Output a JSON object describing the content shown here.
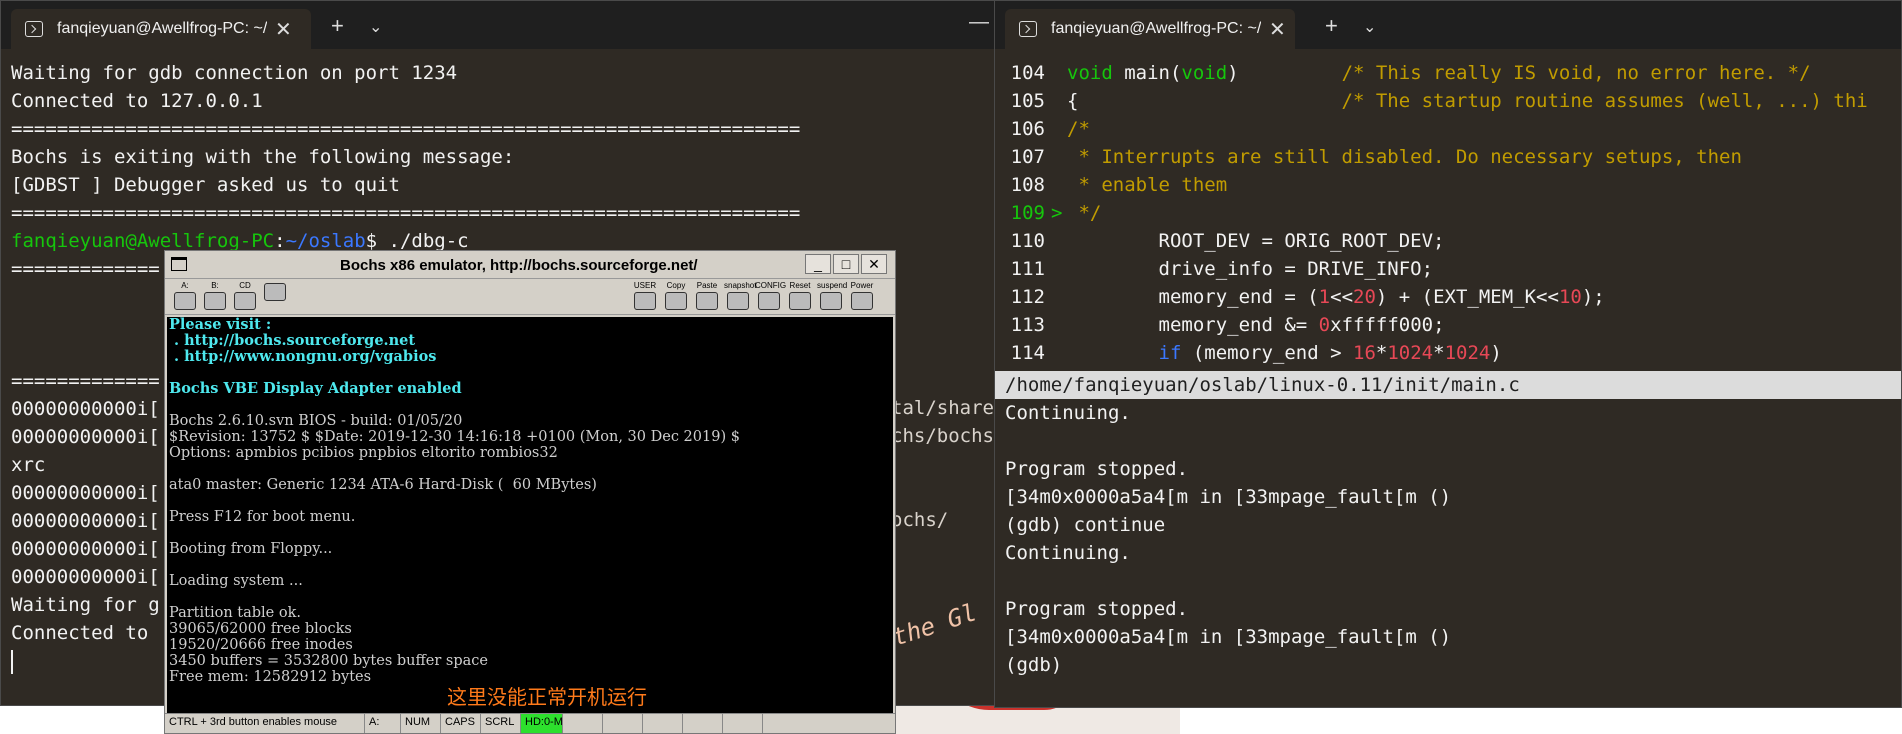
{
  "left_terminal": {
    "tab_title": "fanqieyuan@Awellfrog-PC: ~/",
    "lines": [
      "Waiting for gdb connection on port 1234",
      "Connected to 127.0.0.1",
      "=====================================================================",
      "Bochs is exiting with the following message:",
      "[GDBST ] Debugger asked us to quit",
      "=====================================================================",
      "",
      "=============",
      "",
      "",
      "",
      "=============",
      "00000000000i[",
      "00000000000i[",
      "xrc",
      "00000000000i[",
      "00000000000i[",
      "00000000000i[",
      "00000000000i[",
      "Waiting for g",
      "Connected to "
    ],
    "prompt_user": "fanqieyuan@Awellfrog-PC",
    "prompt_sep": ":",
    "prompt_path": "~/oslab",
    "prompt_cmd": "$ ./dbg-c"
  },
  "right_terminal": {
    "tab_title": "fanqieyuan@Awellfrog-PC: ~/",
    "code_lines": [
      {
        "no": "104",
        "mark": " ",
        "parts": [
          [
            "kw",
            "void"
          ],
          [
            "",
            ""
          ],
          [
            "",
            " main("
          ],
          [
            "kw",
            "void"
          ],
          [
            "",
            ")         "
          ],
          [
            "cm",
            "/* This really IS void, no error here. */"
          ]
        ]
      },
      {
        "no": "105",
        "mark": " ",
        "parts": [
          [
            "",
            "{                       "
          ],
          [
            "cm",
            "/* The startup routine assumes (well, ...) thi"
          ]
        ]
      },
      {
        "no": "106",
        "mark": " ",
        "parts": [
          [
            "cm",
            "/*"
          ]
        ]
      },
      {
        "no": "107",
        "mark": " ",
        "parts": [
          [
            "cm",
            " * Interrupts are still disabled. Do necessary setups, then"
          ]
        ]
      },
      {
        "no": "108",
        "mark": " ",
        "parts": [
          [
            "cm",
            " * enable them"
          ]
        ]
      },
      {
        "no": "109",
        "mark": ">",
        "parts": [
          [
            "cm",
            " */"
          ]
        ]
      },
      {
        "no": "110",
        "mark": " ",
        "parts": [
          [
            "",
            "        ROOT_DEV = ORIG_ROOT_DEV;"
          ]
        ]
      },
      {
        "no": "111",
        "mark": " ",
        "parts": [
          [
            "",
            "        drive_info = DRIVE_INFO;"
          ]
        ]
      },
      {
        "no": "112",
        "mark": " ",
        "parts": [
          [
            "",
            "        memory_end = ("
          ],
          [
            "num",
            "1"
          ],
          [
            "",
            "<<"
          ],
          [
            "num",
            "20"
          ],
          [
            "",
            ") + (EXT_MEM_K<<"
          ],
          [
            "num",
            "10"
          ],
          [
            "",
            ");"
          ]
        ]
      },
      {
        "no": "113",
        "mark": " ",
        "parts": [
          [
            "",
            "        memory_end &= "
          ],
          [
            "num",
            "0"
          ],
          [
            "",
            "xfffff000;"
          ]
        ]
      },
      {
        "no": "114",
        "mark": " ",
        "parts": [
          [
            "",
            "        "
          ],
          [
            "kb",
            "if"
          ],
          [
            "",
            " (memory_end > "
          ],
          [
            "num",
            "16"
          ],
          [
            "",
            "*"
          ],
          [
            "num",
            "1024"
          ],
          [
            "",
            "*"
          ],
          [
            "num",
            "1024"
          ],
          [
            "",
            ")"
          ]
        ]
      }
    ],
    "file_path": "/home/fanqieyuan/oslab/linux-0.11/init/main.c",
    "gdb_lines": [
      "Continuing.",
      "",
      "Program stopped.",
      "[34m0x0000a5a4[m in [33mpage_fault[m ()",
      "(gdb) continue",
      "Continuing.",
      "",
      "Program stopped.",
      "[34m0x0000a5a4[m in [33mpage_fault[m ()",
      "(gdb)"
    ]
  },
  "bochs": {
    "title": "Bochs x86 emulator, http://bochs.sourceforge.net/",
    "toolbar_left": [
      "A:",
      "B:",
      "CD",
      ""
    ],
    "toolbar_right": [
      "USER",
      "Copy",
      "Paste",
      "snapshot",
      "CONFIG",
      "Reset",
      "suspend",
      "Power"
    ],
    "screen_lines": [
      {
        "t": "Please visit :",
        "c": "cy"
      },
      {
        "t": " . http://bochs.sourceforge.net",
        "c": "cy"
      },
      {
        "t": " . http://www.nongnu.org/vgabios",
        "c": "cy"
      },
      {
        "t": "",
        "c": ""
      },
      {
        "t": "Bochs VBE Display Adapter enabled",
        "c": "cy"
      },
      {
        "t": "",
        "c": ""
      },
      {
        "t": "Bochs 2.6.10.svn BIOS - build: 01/05/20",
        "c": ""
      },
      {
        "t": "$Revision: 13752 $ $Date: 2019-12-30 14:16:18 +0100 (Mon, 30 Dec 2019) $",
        "c": ""
      },
      {
        "t": "Options: apmbios pcibios pnpbios eltorito rombios32",
        "c": ""
      },
      {
        "t": "",
        "c": ""
      },
      {
        "t": "ata0 master: Generic 1234 ATA-6 Hard-Disk (  60 MBytes)",
        "c": ""
      },
      {
        "t": "",
        "c": ""
      },
      {
        "t": "Press F12 for boot menu.",
        "c": ""
      },
      {
        "t": "",
        "c": ""
      },
      {
        "t": "Booting from Floppy...",
        "c": ""
      },
      {
        "t": "",
        "c": ""
      },
      {
        "t": "Loading system ...",
        "c": ""
      },
      {
        "t": "",
        "c": ""
      },
      {
        "t": "Partition table ok.",
        "c": ""
      },
      {
        "t": "39065/62000 free blocks",
        "c": ""
      },
      {
        "t": "19520/20666 free inodes",
        "c": ""
      },
      {
        "t": "3450 buffers = 3532800 bytes buffer space",
        "c": ""
      },
      {
        "t": "Free mem: 12582912 bytes",
        "c": ""
      }
    ],
    "annotation": "这里没能正常开机运行",
    "status": [
      "CTRL + 3rd button enables mouse",
      "A:",
      "NUM",
      "CAPS",
      "SCRL",
      "HD:0-M",
      "",
      "",
      "",
      "",
      ""
    ],
    "hd_color": "#2de02d"
  },
  "desktop_text": {
    "share": "tal/share",
    "bochs": "chs/bochs",
    "ochs": "ochs/",
    "the_gl": "the Gl"
  }
}
